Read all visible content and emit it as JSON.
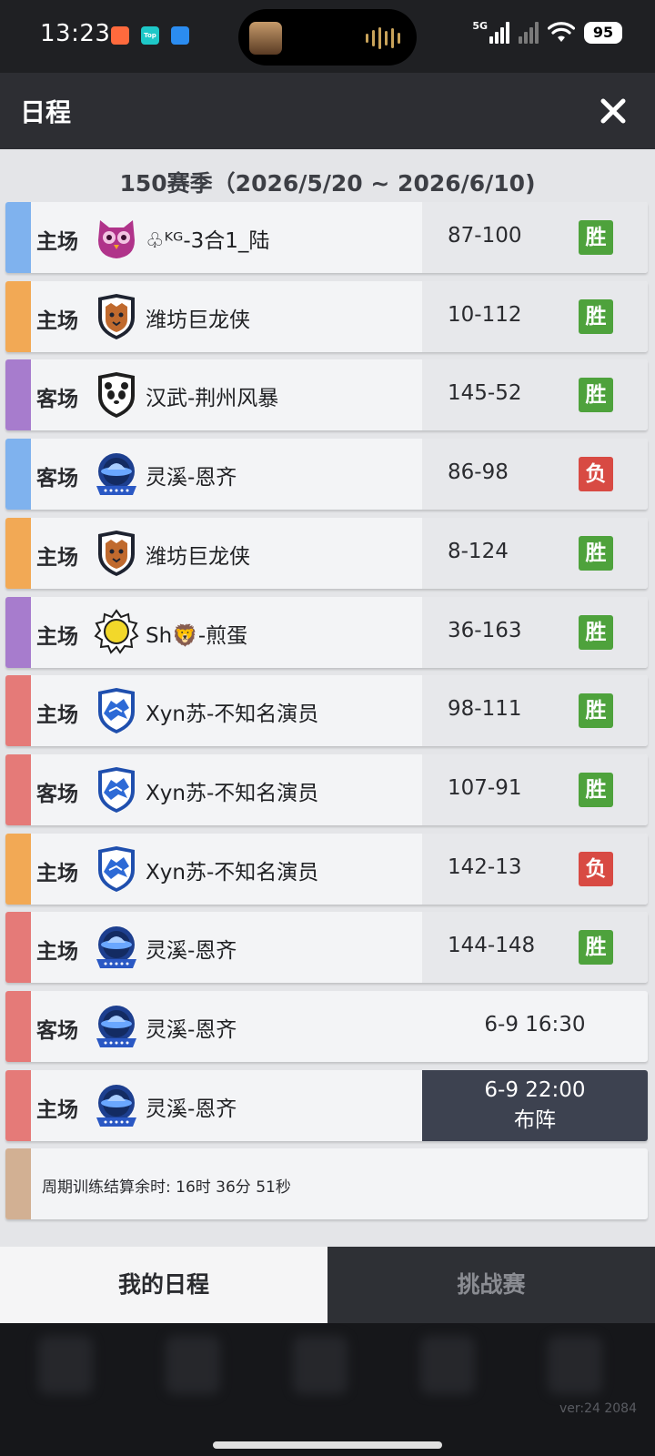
{
  "status_bar": {
    "time": "13:23",
    "network": "5G",
    "battery": "95",
    "notif2_label": "Top"
  },
  "header": {
    "title": "日程"
  },
  "season": {
    "title": "150赛季（2026/5/20 ~ 2026/6/10)"
  },
  "colors": {
    "blue": "#7fb2ee",
    "orange": "#f2a955",
    "purple": "#a77ccd",
    "red": "#e57a78",
    "tan": "#d2b093",
    "win": "#4ea23c",
    "loss": "#d84a43"
  },
  "schedule": [
    {
      "venue": "主场",
      "team": "♧ᴷᴳ-3合1_陆",
      "score": "87-100",
      "result": "胜",
      "color": "blue",
      "logo": "owl-logo-icon"
    },
    {
      "venue": "主场",
      "team": "潍坊巨龙侠",
      "score": "10-112",
      "result": "胜",
      "color": "orange",
      "logo": "tiger-shield-logo-icon"
    },
    {
      "venue": "客场",
      "team": "汉武-荆州风暴",
      "score": "145-52",
      "result": "胜",
      "color": "purple",
      "logo": "panda-shield-logo-icon"
    },
    {
      "venue": "客场",
      "team": "灵溪-恩齐",
      "score": "86-98",
      "result": "负",
      "color": "blue",
      "logo": "ufo-badge-logo-icon"
    },
    {
      "venue": "主场",
      "team": "潍坊巨龙侠",
      "score": "8-124",
      "result": "胜",
      "color": "orange",
      "logo": "tiger-shield-logo-icon"
    },
    {
      "venue": "主场",
      "team": "Sh🦁-煎蛋",
      "score": "36-163",
      "result": "胜",
      "color": "purple",
      "logo": "sun-logo-icon"
    },
    {
      "venue": "主场",
      "team": "Xyn苏-不知名演员",
      "score": "98-111",
      "result": "胜",
      "color": "red",
      "logo": "wolf-shield-logo-icon"
    },
    {
      "venue": "客场",
      "team": "Xyn苏-不知名演员",
      "score": "107-91",
      "result": "胜",
      "color": "red",
      "logo": "wolf-shield-logo-icon"
    },
    {
      "venue": "主场",
      "team": "Xyn苏-不知名演员",
      "score": "142-13",
      "result": "负",
      "color": "orange",
      "logo": "wolf-shield-logo-icon"
    },
    {
      "venue": "主场",
      "team": "灵溪-恩齐",
      "score": "144-148",
      "result": "胜",
      "color": "red",
      "logo": "ufo-badge-logo-icon"
    },
    {
      "venue": "客场",
      "team": "灵溪-恩齐",
      "time": "6-9 16:30",
      "color": "red",
      "logo": "ufo-badge-logo-icon"
    },
    {
      "venue": "主场",
      "team": "灵溪-恩齐",
      "time": "6-9 22:00",
      "action": "布阵",
      "color": "red",
      "logo": "ufo-badge-logo-icon"
    }
  ],
  "timer": {
    "text": "周期训练结算余时: 16时 36分 51秒",
    "color": "tan"
  },
  "tabs": {
    "my_schedule": "我的日程",
    "challenge": "挑战赛"
  },
  "footer": {
    "version": "ver:24  2084"
  }
}
